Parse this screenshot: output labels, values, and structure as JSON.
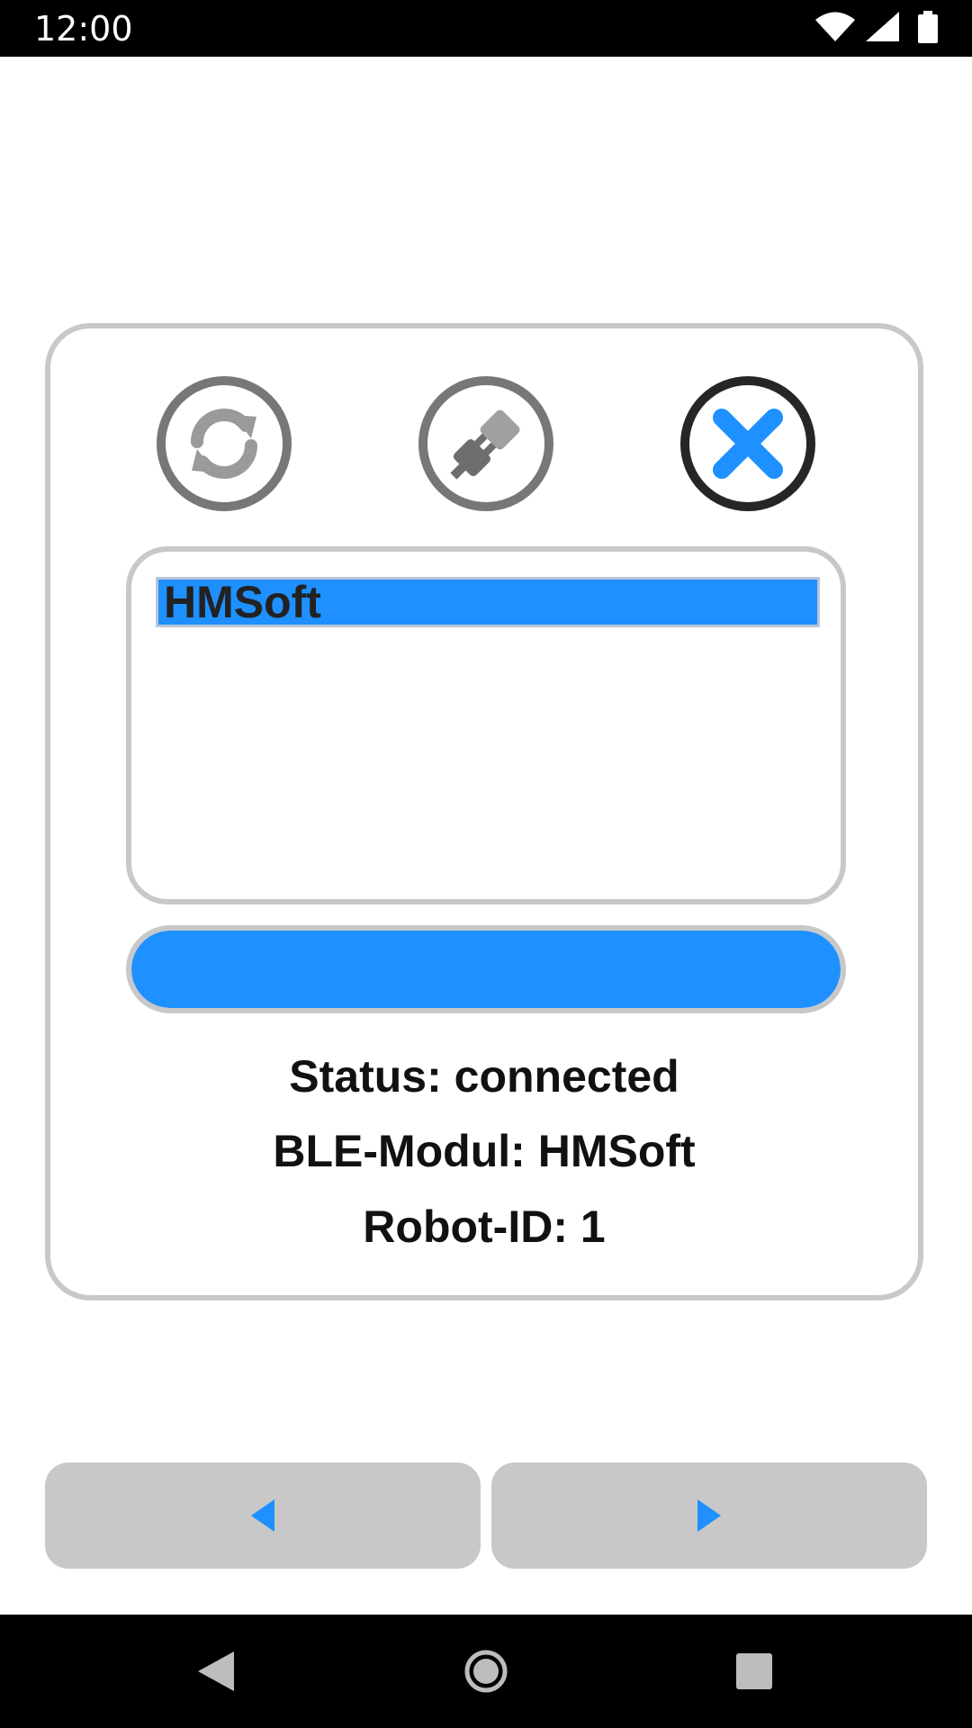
{
  "status_bar": {
    "time": "12:00",
    "icons": [
      "wifi-icon",
      "cell-signal-icon",
      "battery-icon"
    ]
  },
  "panel": {
    "toolbar": {
      "buttons": [
        {
          "name": "refresh-button",
          "icon": "refresh-icon",
          "state": "disabled"
        },
        {
          "name": "connect-button",
          "icon": "plug-icon",
          "state": "disabled"
        },
        {
          "name": "disconnect-button",
          "icon": "close-icon",
          "state": "enabled",
          "accent": "#1e90ff"
        }
      ]
    },
    "device_list": {
      "items": [
        {
          "label": "HMSoft",
          "selected": true
        }
      ]
    },
    "progress": {
      "value": 1.0,
      "color": "#1e90ff"
    },
    "status": "Status: connected",
    "module": "BLE-Modul: HMSoft",
    "robot_id": "Robot-ID: 1"
  },
  "navigation": {
    "back_icon": "triangle-left-icon",
    "forward_icon": "triangle-right-icon",
    "arrow_color": "#1e90ff",
    "button_color": "#c8c8c8"
  },
  "system_nav": {
    "icons": [
      "back-icon",
      "home-icon",
      "recents-icon"
    ]
  }
}
